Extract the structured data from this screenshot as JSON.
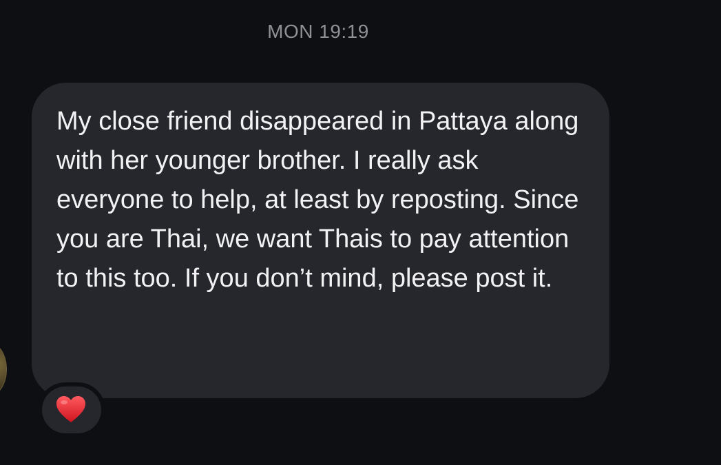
{
  "chat": {
    "timestamp": "MON 19:19",
    "message": {
      "text": "My close friend disappeared in Pattaya along with her younger brother. I really ask everyone to help, at least by reposting. Since you are Thai, we want Thais to pay attention to this too. If you don’t mind, please post it.",
      "bubble_color": "#25272c",
      "text_color": "#f2f2f4"
    },
    "reaction": {
      "icon": "red-heart-icon",
      "color": "#e0242f"
    }
  },
  "theme": {
    "background": "#0d0f13",
    "timestamp_color": "#8e9096"
  }
}
